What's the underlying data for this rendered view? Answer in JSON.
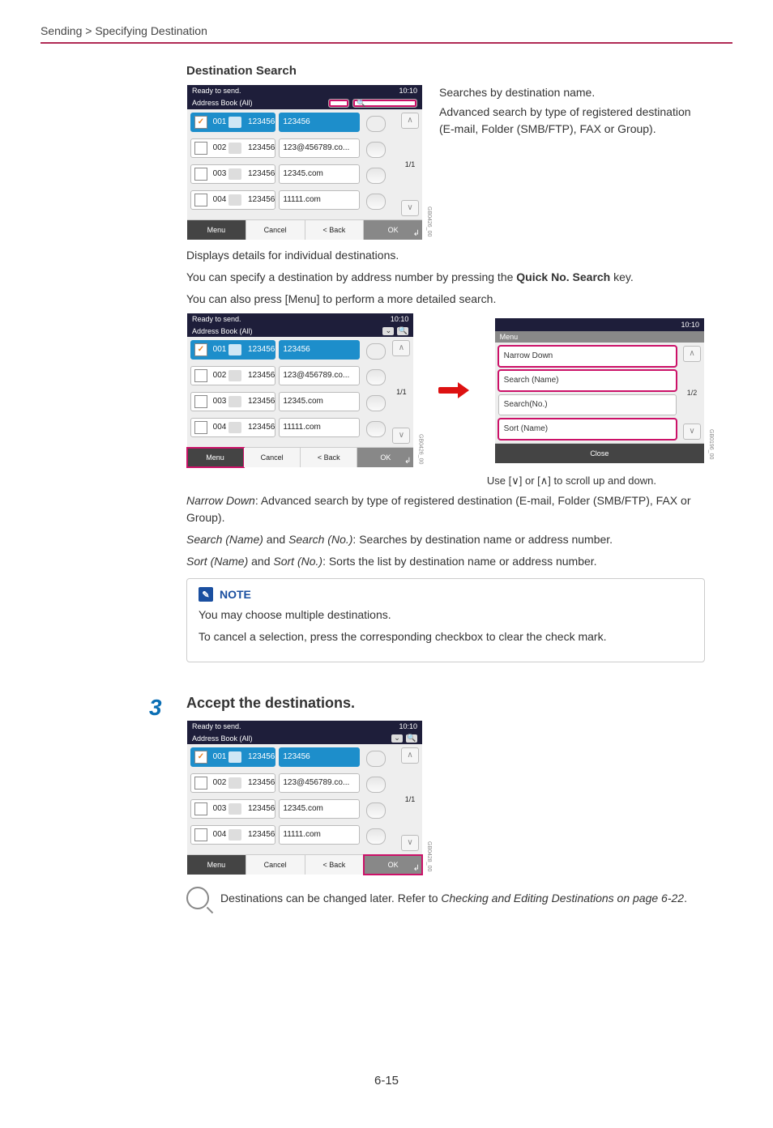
{
  "breadcrumb": "Sending > Specifying Destination",
  "section_title": "Destination Search",
  "panel": {
    "status": "Ready to send.",
    "time": "10:10",
    "title": "Address Book (All)",
    "page": "1/1",
    "rows": [
      {
        "no": "001",
        "name": "123456",
        "addr": "123456",
        "selected": true
      },
      {
        "no": "002",
        "name": "123456",
        "addr": "123@456789.co..."
      },
      {
        "no": "003",
        "name": "123456",
        "addr": "12345.com"
      },
      {
        "no": "004",
        "name": "123456",
        "addr": "11111.com"
      }
    ],
    "buttons": {
      "menu": "Menu",
      "cancel": "Cancel",
      "back": "< Back",
      "ok": "OK"
    },
    "gbcode": "GB0426_00"
  },
  "annot1_line1": "Searches by destination name.",
  "annot1_line2": "Advanced search by type of registered destination (E-mail, Folder (SMB/FTP), FAX or Group).",
  "detail_text": "Displays details for individual destinations.",
  "quick_search_text_a": "You can specify a destination by address number by pressing the ",
  "quick_search_text_b": "Quick No. Search",
  "quick_search_text_c": " key.",
  "menu_more_text": "You can also press [Menu] to perform a more detailed search.",
  "menu_panel": {
    "time": "10:10",
    "title": "Menu",
    "page": "1/2",
    "items": [
      "Narrow Down",
      "Search (Name)",
      "Search(No.)",
      "Sort (Name)"
    ],
    "close": "Close",
    "gbcode": "GB0196_00"
  },
  "scroll_hint": "Use [∨] or [∧] to scroll up and down.",
  "narrow_down_label": "Narrow Down",
  "narrow_down_text": ": Advanced search by type of registered destination (E-mail, Folder (SMB/FTP), FAX or Group).",
  "search_names_a": "Search (Name)",
  "search_names_mid": " and ",
  "search_names_b": "Search (No.)",
  "search_names_text": ": Searches by destination name or address number.",
  "sort_a": "Sort (Name)",
  "sort_b": "Sort (No.)",
  "sort_text": ": Sorts the list by destination name or address number.",
  "note_label": "NOTE",
  "note_line1": "You may choose multiple destinations.",
  "note_line2": "To cancel a selection, press the corresponding checkbox to clear the check mark.",
  "step_num": "3",
  "step_title": "Accept the destinations.",
  "panel3_gbcode": "GB0428_00",
  "ref_text_a": "Destinations can be changed later. Refer to ",
  "ref_text_b": "Checking and Editing Destinations on page 6-22",
  "page_num": "6-15"
}
